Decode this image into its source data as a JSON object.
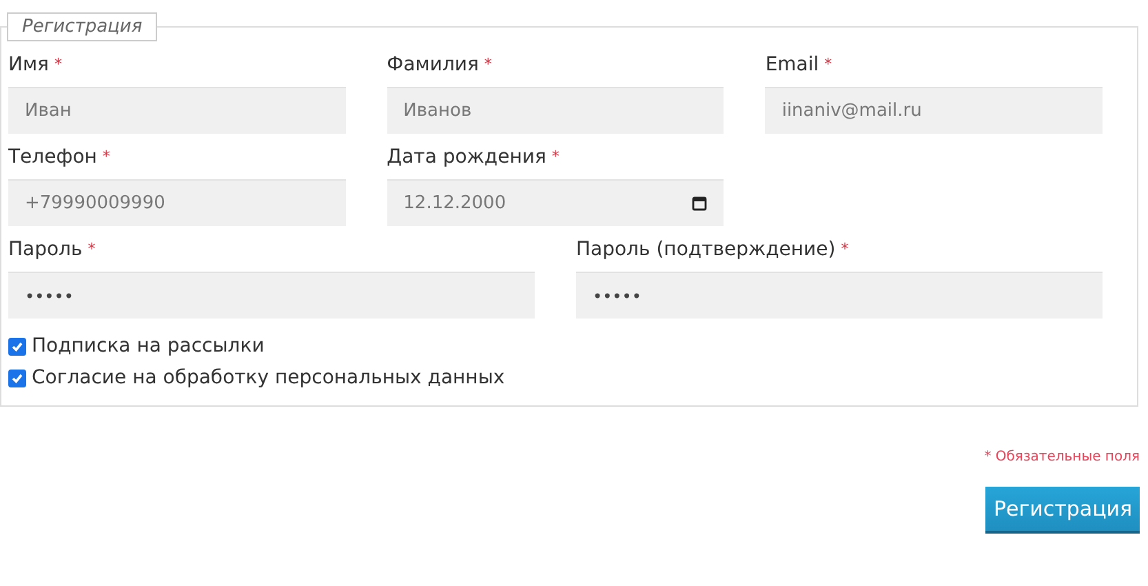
{
  "legend": "Регистрация",
  "rows": [
    {
      "fields": [
        {
          "label": "Имя",
          "required": true,
          "kind": "text",
          "value": "Иван"
        },
        {
          "label": "Фамилия",
          "required": true,
          "kind": "text",
          "value": "Иванов"
        },
        {
          "label": "Email",
          "required": true,
          "kind": "text",
          "value": "iinaniv@mail.ru"
        }
      ]
    },
    {
      "fields": [
        {
          "label": "Телефон",
          "required": true,
          "kind": "text",
          "value": "+79990009990"
        },
        {
          "label": "Дата рождения",
          "required": true,
          "kind": "date",
          "value": "12.12.2000"
        }
      ]
    },
    {
      "fields": [
        {
          "label": "Пароль",
          "required": true,
          "kind": "password",
          "value": "•••••"
        },
        {
          "label": "Пароль (подтверждение)",
          "required": true,
          "kind": "password",
          "value": "•••••"
        }
      ]
    }
  ],
  "required_marker": "*",
  "checkboxes": [
    {
      "label": "Подписка на рассылки",
      "checked": true
    },
    {
      "label": "Согласие на обработку персональных данных",
      "checked": true
    }
  ],
  "required_note": "* Обязательные поля",
  "submit": "Регистрация"
}
